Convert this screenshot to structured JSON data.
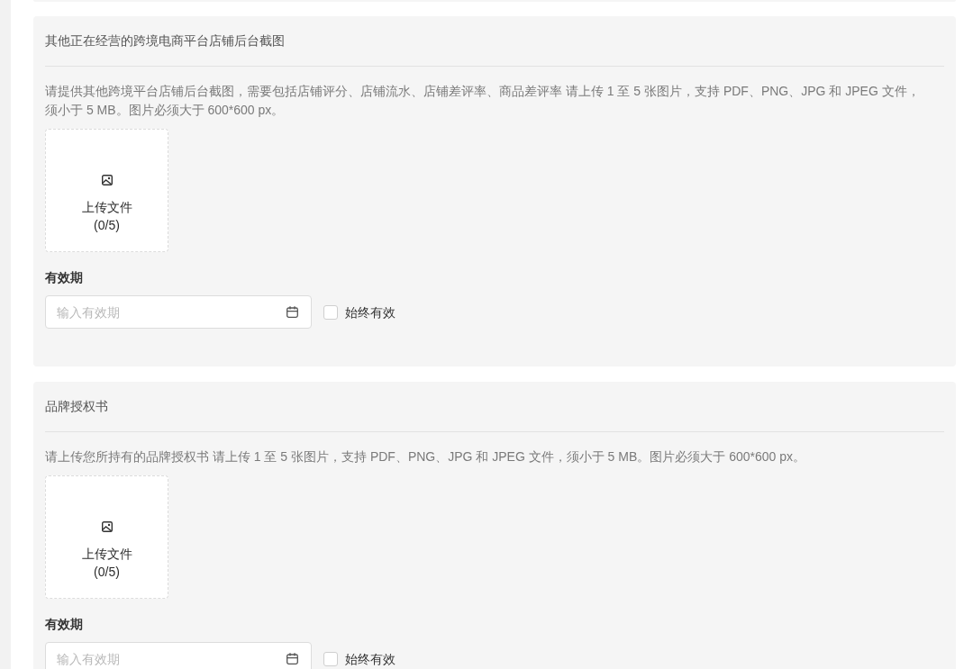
{
  "sections": [
    {
      "title": "其他正在经营的跨境电商平台店铺后台截图",
      "description": "请提供其他跨境平台店铺后台截图，需要包括店铺评分、店铺流水、店铺差评率、商品差评率 请上传 1 至 5 张图片，支持 PDF、PNG、JPG 和 JPEG 文件，须小于 5 MB。图片必须大于 600*600 px。",
      "upload": {
        "label": "上传文件",
        "count": "(0/5)"
      },
      "validity": {
        "label": "有效期",
        "date_field": {
          "placeholder": "输入有效期"
        },
        "always_valid": {
          "label": "始终有效",
          "checked": false
        }
      }
    },
    {
      "title": "品牌授权书",
      "description": "请上传您所持有的品牌授权书 请上传 1 至 5 张图片，支持 PDF、PNG、JPG 和 JPEG 文件，须小于 5 MB。图片必须大于 600*600 px。",
      "upload": {
        "label": "上传文件",
        "count": "(0/5)"
      },
      "validity": {
        "label": "有效期",
        "date_field": {
          "placeholder": "输入有效期"
        },
        "always_valid": {
          "label": "始终有效",
          "checked": false
        }
      }
    }
  ]
}
